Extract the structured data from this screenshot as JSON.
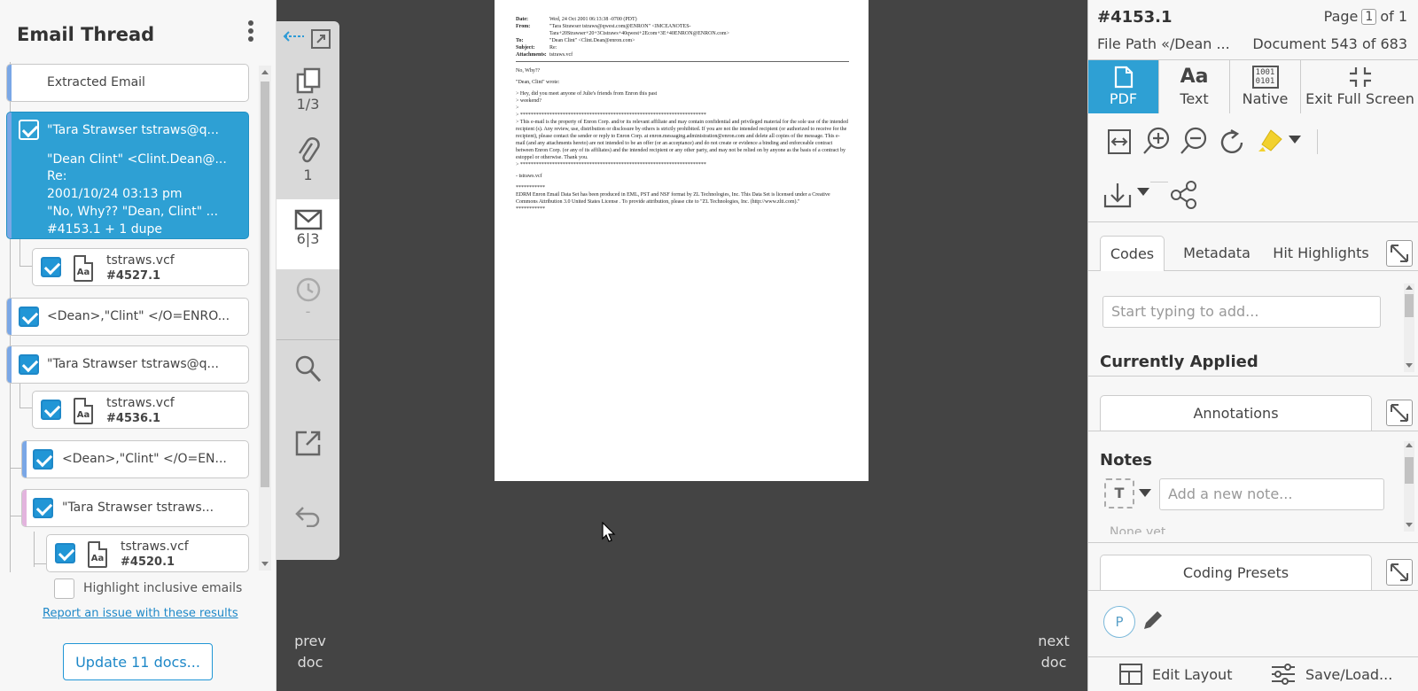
{
  "left": {
    "title": "Email Thread",
    "items": [
      {
        "lines": [
          "Extracted Email"
        ]
      },
      {
        "lines": [
          "\"Tara Strawser tstraws@q...",
          "\"Dean Clint\" <Clint.Dean@...",
          "Re:",
          "2001/10/24 03:13 pm",
          "\"No, Why?? \"Dean, Clint\" ...",
          "#4153.1 + 1 dupe"
        ]
      },
      {
        "name": "tstraws.vcf",
        "id": "#4527.1"
      },
      {
        "lines": [
          "<Dean>,\"Clint\" </O=ENRO..."
        ]
      },
      {
        "lines": [
          "\"Tara Strawser tstraws@q..."
        ]
      },
      {
        "name": "tstraws.vcf",
        "id": "#4536.1"
      },
      {
        "lines": [
          "<Dean>,\"Clint\" </O=EN..."
        ]
      },
      {
        "lines": [
          "\"Tara Strawser tstraws..."
        ]
      },
      {
        "name": "tstraws.vcf",
        "id": "#4520.1"
      }
    ],
    "file_icon_text": "Aa",
    "highlight_label": "Highlight inclusive emails",
    "report_link": "Report an issue with these results",
    "update_button": "Update 11 docs..."
  },
  "strip": {
    "pages": "1/3",
    "attachments": "1",
    "email": "6|3",
    "history": "-"
  },
  "viewer": {
    "prev": [
      "prev",
      "doc"
    ],
    "next": [
      "next",
      "doc"
    ],
    "doc": {
      "headers": [
        {
          "k": "Date:",
          "v": "Wed, 24 Oct 2001 06:13:38 -0700 (PDT)"
        },
        {
          "k": "From:",
          "v": "\"Tara Strawser tstraws@qwest.com@ENRON\" <IMCEANOTES-Tara+20Strawser+20+3Ctstraws+40qwest+2Ecom+3E+40ENRON@ENRON.com>"
        },
        {
          "k": "To:",
          "v": "\"Dean Clint\" <Clint.Dean@enron.com>"
        },
        {
          "k": "Subject:",
          "v": "Re:"
        },
        {
          "k": "Attachments:",
          "v": "tstraws.vcf"
        }
      ],
      "body": [
        "No, Why??",
        "\"Dean, Clint\" wrote:",
        "> Hey, did you meet anyone of Julie's friends from Enron this past\n> weekend?\n>\n> **********************************************************************\n> This e-mail is the property of Enron Corp. and/or its relevant affiliate and may contain confidential and privileged material for the sole use of the intended recipient (s). Any review, use, distribution or disclosure by others is strictly prohibited. If you are not the intended recipient (or authorized to receive for the recipient), please contact the sender or reply to Enron Corp. at enron.messaging.administration@enron.com and delete all copies of the message. This e-mail (and any attachments hereto) are not intended to be an offer (or an acceptance) and do not create or evidence a binding and enforceable contract between Enron Corp. (or any of its affiliates) and the intended recipient or any other party, and may not be relied on by anyone as the basis of a contract by estoppel or otherwise. Thank you.\n> **********************************************************************",
        "- tstraws.vcf",
        "***********\nEDRM Enron Email Data Set has been produced in EML, PST and NSF format by ZL Technologies, Inc. This Data Set is licensed under a Creative Commons Attribution 3.0 United States License . To provide attribution, please cite to \"ZL Technologies, Inc. (http://www.zlti.com).\"\n***********"
      ]
    }
  },
  "right": {
    "doc_id": "#4153.1",
    "page_label": "Page",
    "page_current": "1",
    "page_total": "of 1",
    "file_path": "File Path «/Dean ...",
    "doc_count": "Document 543 of 683",
    "view_tabs": [
      "PDF",
      "Text",
      "Native",
      "Exit Full Screen"
    ],
    "text_icon": "Aa",
    "native_icon": [
      "1001",
      "0101"
    ],
    "code_tabs": [
      "Codes",
      "Metadata",
      "Hit Highlights"
    ],
    "codes_placeholder": "Start typing to add...",
    "currently_applied": "Currently Applied",
    "annotations": "Annotations",
    "notes_title": "Notes",
    "note_type": "T",
    "note_placeholder": "Add a new note...",
    "notes_empty": "None yet",
    "coding_presets": "Coding Presets",
    "preset_initial": "P",
    "edit_layout": "Edit Layout",
    "save_load": "Save/Load..."
  },
  "colors": {
    "accent": "#2ea0d4",
    "bar_blue": "#7aa7e6",
    "bar_pink": "#e3b4de",
    "viewer_bg": "#444444"
  }
}
